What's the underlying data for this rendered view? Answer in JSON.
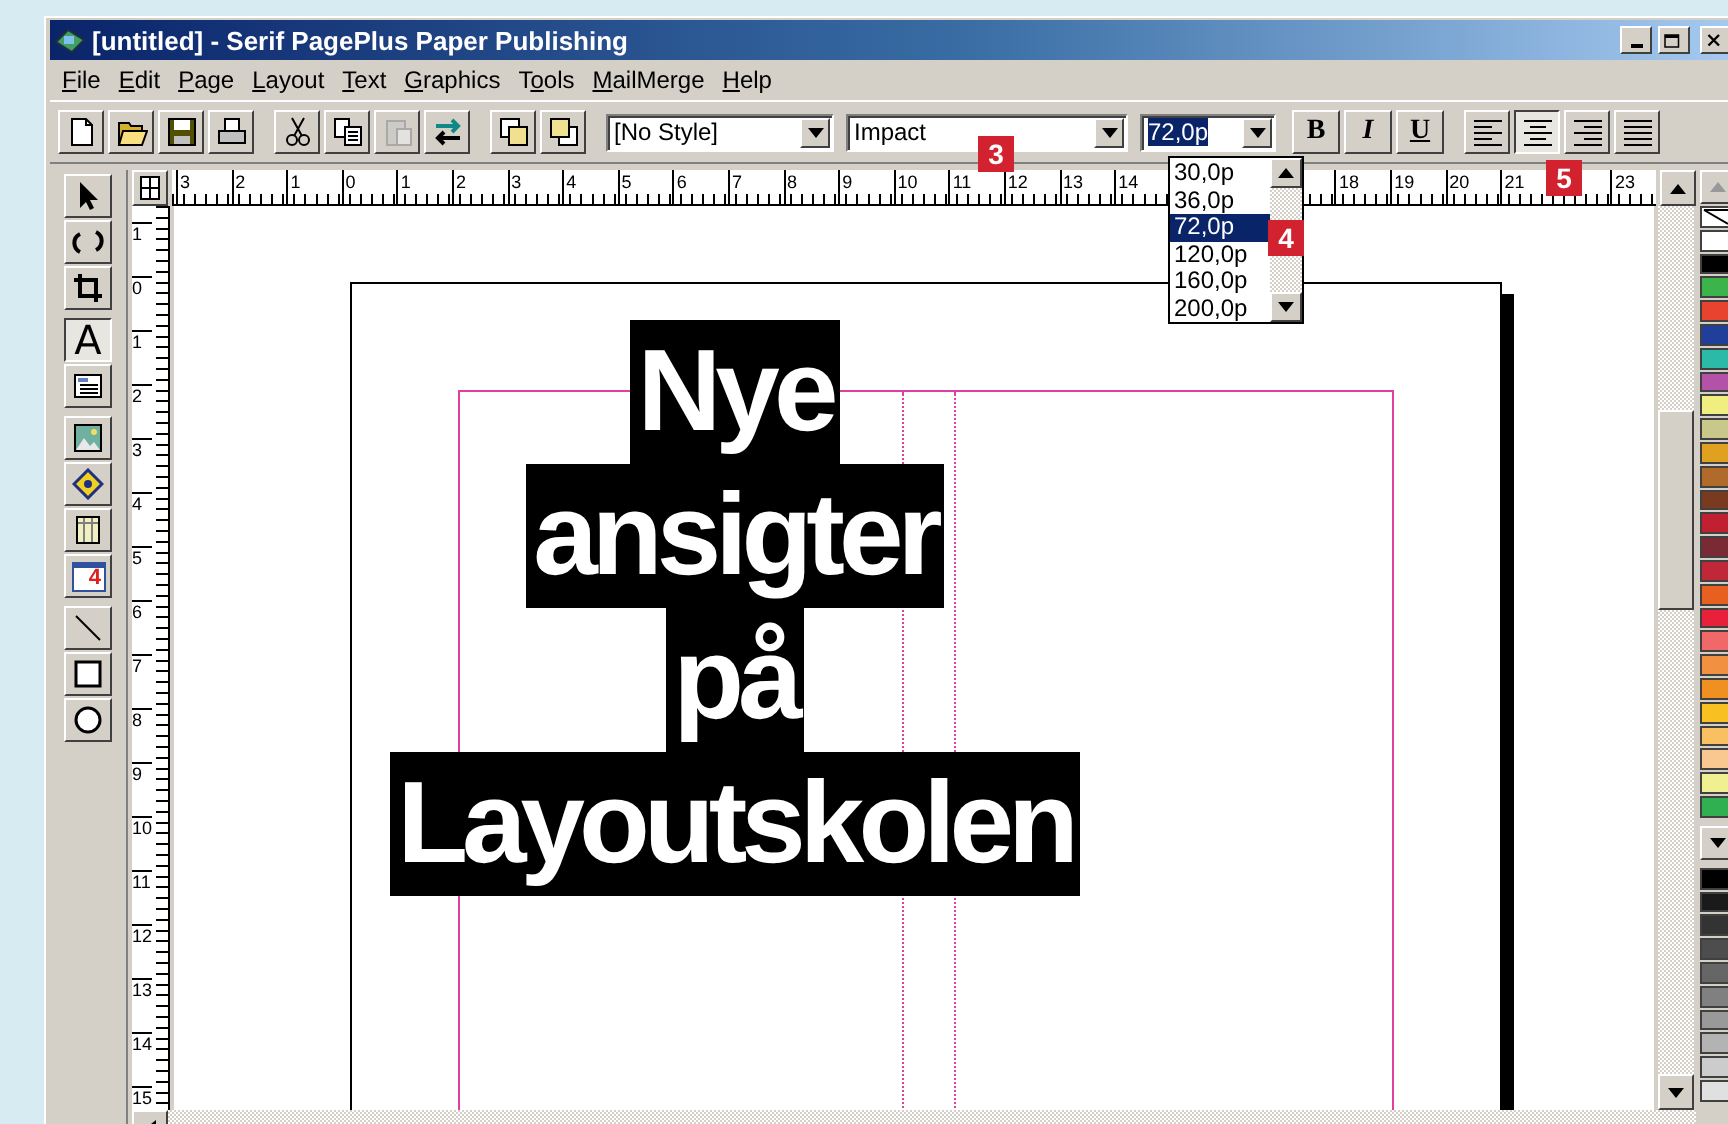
{
  "window": {
    "title": "[untitled] - Serif PagePlus Paper Publishing",
    "controls": [
      {
        "kind": "minimize"
      },
      {
        "kind": "maximize"
      },
      {
        "kind": "close"
      }
    ]
  },
  "menu": [
    {
      "key": "F",
      "after": "ile"
    },
    {
      "key": "E",
      "after": "dit"
    },
    {
      "key": "P",
      "after": "age"
    },
    {
      "key": "L",
      "after": "ayout"
    },
    {
      "key": "T",
      "after": "ext"
    },
    {
      "key": "G",
      "after": "raphics"
    },
    {
      "before": "T",
      "key": "o",
      "after": "ols"
    },
    {
      "key": "M",
      "after": "ailMerge"
    },
    {
      "key": "H",
      "after": "elp"
    }
  ],
  "toolbar": {
    "groups": [
      [
        {
          "kind": "new",
          "disabled": false
        },
        {
          "kind": "open",
          "disabled": false
        },
        {
          "kind": "save",
          "disabled": false
        },
        {
          "kind": "print",
          "disabled": false
        }
      ],
      [
        {
          "kind": "cut",
          "disabled": false
        },
        {
          "kind": "copy",
          "disabled": false
        },
        {
          "kind": "paste",
          "disabled": true
        },
        {
          "kind": "swap",
          "disabled": false
        }
      ],
      [
        {
          "kind": "front",
          "disabled": false
        },
        {
          "kind": "back",
          "disabled": false
        }
      ]
    ],
    "style_combo": {
      "value": "[No Style]"
    },
    "font_combo": {
      "value": "Impact"
    },
    "size_combo": {
      "value": "72,0p"
    },
    "format": [
      {
        "kind": "bold",
        "label": "B"
      },
      {
        "kind": "italic",
        "label": "I"
      },
      {
        "kind": "underline",
        "label": "U"
      }
    ],
    "align": [
      {
        "kind": "left",
        "selected": false
      },
      {
        "kind": "center",
        "selected": true
      },
      {
        "kind": "right",
        "selected": false
      },
      {
        "kind": "justify",
        "selected": false
      }
    ]
  },
  "size_dropdown": {
    "options": [
      {
        "label": "30,0p",
        "selected": false
      },
      {
        "label": "36,0p",
        "selected": false
      },
      {
        "label": "72,0p",
        "selected": true
      },
      {
        "label": "120,0p",
        "selected": false
      },
      {
        "label": "160,0p",
        "selected": false
      },
      {
        "label": "200,0p",
        "selected": false
      }
    ]
  },
  "tools": [
    [
      {
        "kind": "pointer",
        "selected": false
      },
      {
        "kind": "rotate",
        "selected": false
      },
      {
        "kind": "crop",
        "selected": false
      }
    ],
    [
      {
        "kind": "text",
        "glyph": "A",
        "selected": true
      },
      {
        "kind": "frame",
        "selected": false
      }
    ],
    [
      {
        "kind": "picture",
        "selected": false
      },
      {
        "kind": "object",
        "selected": false
      },
      {
        "kind": "table",
        "selected": false
      },
      {
        "kind": "calendar",
        "glyph": "4",
        "selected": false
      }
    ],
    [
      {
        "kind": "line",
        "selected": false
      },
      {
        "kind": "rectangle",
        "selected": false
      },
      {
        "kind": "ellipse",
        "selected": false
      }
    ]
  ],
  "ruler_h": {
    "segments": [
      [
        "3",
        "2",
        "1",
        "0",
        "1",
        "2",
        "3",
        "4",
        "5",
        "6",
        "7",
        "8",
        "9",
        "10",
        "11",
        "12",
        "13",
        "14"
      ],
      [
        "18",
        "19",
        "20",
        "21"
      ],
      [
        "23"
      ]
    ]
  },
  "ruler_v": {
    "labels": [
      "1",
      "0",
      "1",
      "2",
      "3",
      "4",
      "5",
      "6",
      "7",
      "8",
      "9",
      "10",
      "11",
      "12",
      "13",
      "14",
      "15"
    ]
  },
  "headline": {
    "lines": [
      "Nye",
      "ansigter",
      "på",
      "Layoutskolen"
    ]
  },
  "palette": {
    "top": [
      {
        "kind": "none"
      },
      {
        "kind": "swatch",
        "color": "#ffffff"
      },
      {
        "kind": "swatch",
        "color": "#000000"
      },
      {
        "kind": "swatch",
        "color": "#3cb44b"
      },
      {
        "kind": "swatch",
        "color": "#e8432e"
      },
      {
        "kind": "swatch",
        "color": "#1f3f9a"
      },
      {
        "kind": "swatch",
        "color": "#2bb9a8"
      },
      {
        "kind": "swatch",
        "color": "#b452a8"
      },
      {
        "kind": "swatch",
        "color": "#f0ee80"
      },
      {
        "kind": "swatch",
        "color": "#c8c88a"
      },
      {
        "kind": "swatch",
        "color": "#e0a020"
      },
      {
        "kind": "swatch",
        "color": "#b06a2a"
      },
      {
        "kind": "swatch",
        "color": "#7a3a20"
      },
      {
        "kind": "swatch",
        "color": "#c02030"
      },
      {
        "kind": "swatch",
        "color": "#7a2a35"
      },
      {
        "kind": "swatch",
        "color": "#c0283a"
      },
      {
        "kind": "swatch",
        "color": "#e86020"
      },
      {
        "kind": "swatch",
        "color": "#e8203a"
      },
      {
        "kind": "swatch",
        "color": "#f06868"
      },
      {
        "kind": "swatch",
        "color": "#f09040"
      },
      {
        "kind": "swatch",
        "color": "#f09020"
      },
      {
        "kind": "swatch",
        "color": "#f8c020"
      },
      {
        "kind": "swatch",
        "color": "#f8c060"
      },
      {
        "kind": "swatch",
        "color": "#f8c890"
      },
      {
        "kind": "swatch",
        "color": "#f0f090"
      },
      {
        "kind": "swatch",
        "color": "#30b050"
      }
    ],
    "greys": [
      {
        "color": "#000000"
      },
      {
        "color": "#1a1a1a"
      },
      {
        "color": "#333333"
      },
      {
        "color": "#4d4d4d"
      },
      {
        "color": "#666666"
      },
      {
        "color": "#808080"
      },
      {
        "color": "#999999"
      },
      {
        "color": "#b3b3b3"
      },
      {
        "color": "#cccccc"
      },
      {
        "color": "#e0e0e0"
      }
    ]
  },
  "callouts": [
    {
      "label": "3"
    },
    {
      "label": "4"
    },
    {
      "label": "5"
    }
  ]
}
